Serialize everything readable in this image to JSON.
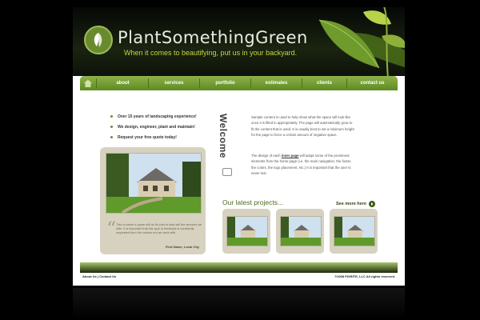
{
  "header": {
    "brand": "PlantSomethingGreen",
    "tagline": "When it comes to beautifying, put us in your backyard."
  },
  "nav": {
    "items": [
      "about",
      "services",
      "portfolio",
      "estimates",
      "clients",
      "contact us"
    ]
  },
  "bullets": [
    "Over 15 years of landscaping experience!",
    "We design, engineer, plant and maintain!",
    "Request your free quote today!"
  ],
  "testimonial": {
    "text": "This is where a quote will do it's part to help sell the services we offer. It is important that this type of feedback is constantly requested from the custom ers we work with.",
    "author": "First Name, Local City"
  },
  "welcome": {
    "heading": "Welcome",
    "p1": "Sample content is used to help show what the space will look like once it is filled in appropriately. The page will automatically grow to fit the content that is used. It is usually best to set a minimum height for the page to force a certain amount of negative space.",
    "p2_before": "The design of each ",
    "p2_link": "inner page",
    "p2_after": " will adopt some of the prominent elements from the home page (i.e. the main navigation, the footer, the colors, the logo placement, etc.) It is important that the user is never lost."
  },
  "projects": {
    "heading": "Our latest projects...",
    "see_more": "See more here"
  },
  "footer": {
    "links": "About Us | Contact Us",
    "copyright": "©2008 PIXRITE, LLC All rights reserved."
  },
  "colors": {
    "accent_green": "#6b8a2c",
    "tagline_yellow": "#c9d63a"
  }
}
